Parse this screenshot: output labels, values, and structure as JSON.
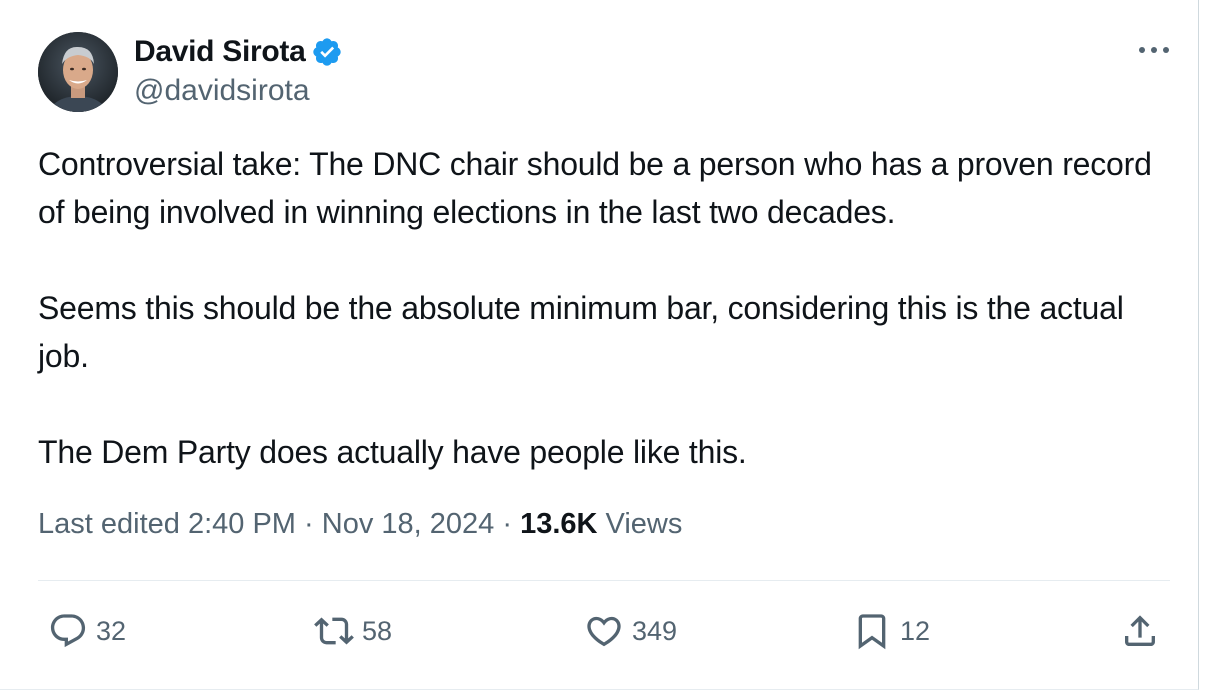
{
  "author": {
    "display_name": "David Sirota",
    "handle": "@davidsirota",
    "verified": true,
    "avatar": "avatar-photo"
  },
  "tweet": {
    "paragraphs": [
      "Controversial take: The DNC chair should be a person who has a proven record of being involved in winning elections in the last two decades.",
      "Seems this should be the absolute minimum bar, considering this is the actual job.",
      "The Dem Party does actually have people like this."
    ]
  },
  "meta": {
    "edited_label": "Last edited",
    "time": "2:40 PM",
    "separator": "·",
    "date": "Nov 18, 2024",
    "views_count": "13.6K",
    "views_label": "Views"
  },
  "actions": {
    "replies": "32",
    "reposts": "58",
    "likes": "349",
    "bookmarks": "12"
  },
  "icons": {
    "verified": "verified-badge-icon",
    "more": "more-icon",
    "reply": "reply-icon",
    "repost": "repost-icon",
    "like": "heart-icon",
    "bookmark": "bookmark-icon",
    "share": "share-icon"
  },
  "colors": {
    "text_primary": "#0f1419",
    "text_secondary": "#536471",
    "verified_blue": "#1d9bf0",
    "divider": "#e6ecf0"
  }
}
